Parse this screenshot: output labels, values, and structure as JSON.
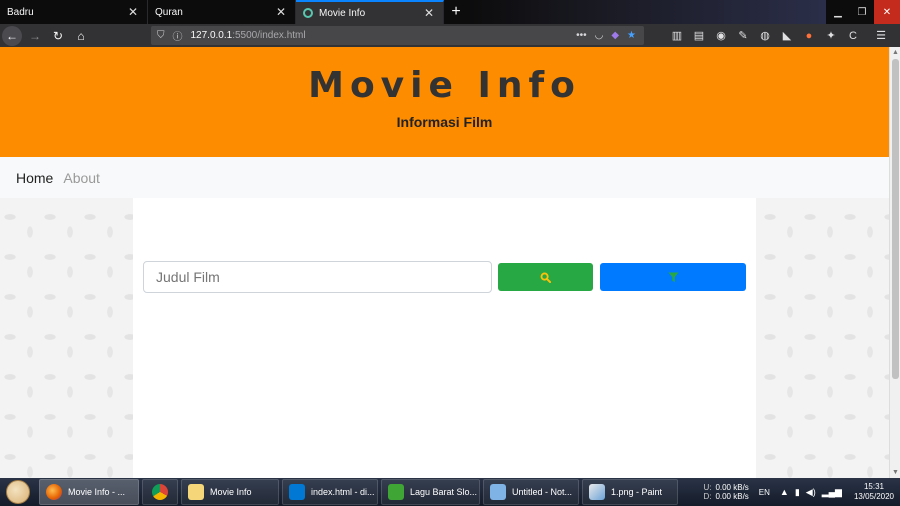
{
  "browser": {
    "tabs": [
      {
        "label": "Badru",
        "active": false
      },
      {
        "label": "Quran",
        "active": false
      },
      {
        "label": "Movie Info",
        "active": true
      }
    ],
    "new_tab": "+",
    "url_host": "127.0.0.1",
    "url_path": ":5500/index.html",
    "url_dots": "•••"
  },
  "page": {
    "title": "Movie Info",
    "subtitle": "Informasi Film",
    "nav": [
      {
        "label": "Home",
        "active": true
      },
      {
        "label": "About",
        "active": false
      }
    ],
    "search": {
      "placeholder": "Judul Film",
      "value": ""
    },
    "colors": {
      "header": "#fe8c00",
      "search_button": "#28a745",
      "filter_button": "#007bff",
      "search_icon": "#ffc107",
      "filter_icon": "#28a745"
    }
  },
  "taskbar": {
    "items": [
      {
        "label": "Movie Info - ...",
        "icon": "firefox-icon",
        "active": true
      },
      {
        "label": "",
        "icon": "chrome-icon",
        "active": false
      },
      {
        "label": "Movie Info",
        "icon": "folder-icon",
        "active": false
      },
      {
        "label": "index.html - di...",
        "icon": "vscode-icon",
        "active": false
      },
      {
        "label": "Lagu Barat Slo...",
        "icon": "media-player-icon",
        "active": false
      },
      {
        "label": "Untitled - Not...",
        "icon": "notepad-icon",
        "active": false
      },
      {
        "label": "1.png - Paint",
        "icon": "paint-icon",
        "active": false
      }
    ],
    "net_up_label": "U:",
    "net_down_label": "D:",
    "net_up": "0.00 kB/s",
    "net_down": "0.00 kB/s",
    "language": "EN",
    "time": "15:31",
    "date": "13/05/2020"
  }
}
